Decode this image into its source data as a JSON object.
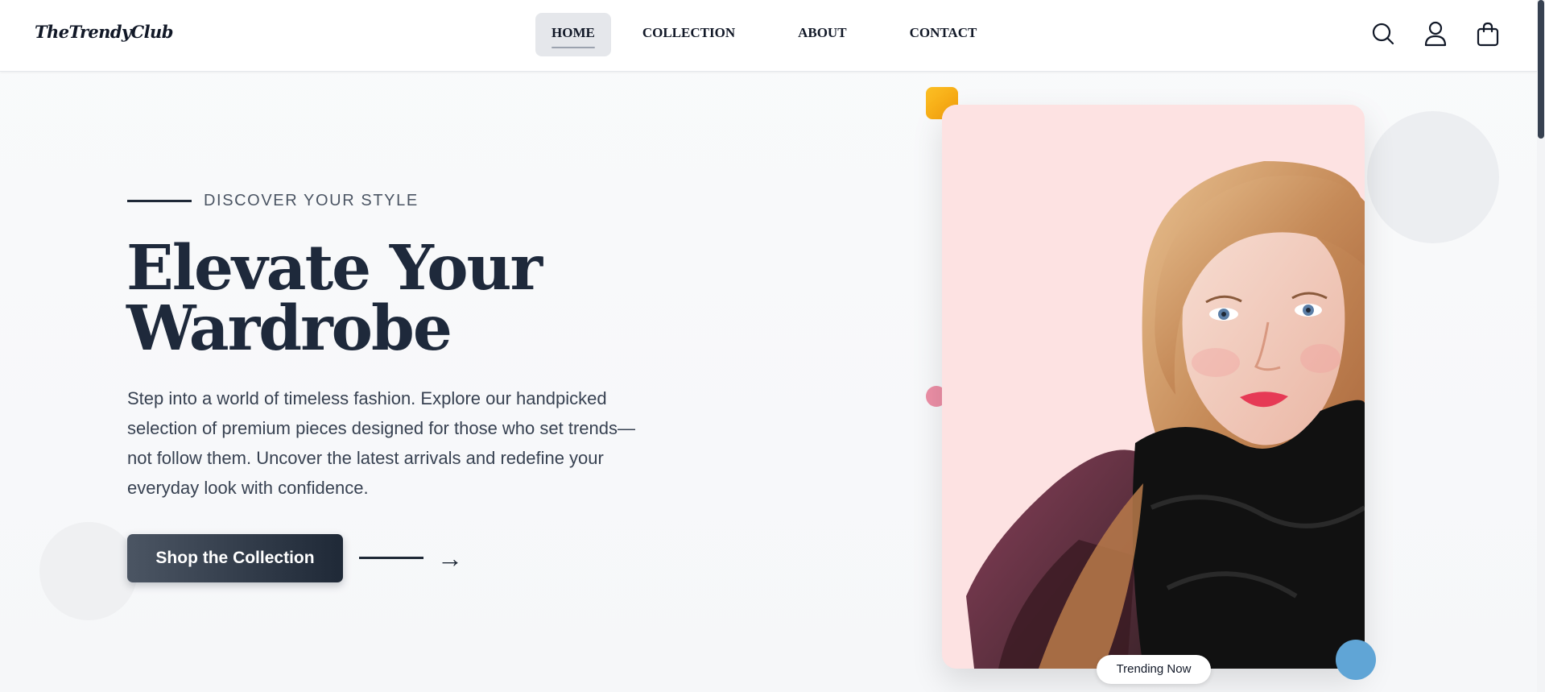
{
  "header": {
    "logo": "TheTrendyClub",
    "nav": [
      {
        "label": "HOME",
        "active": true
      },
      {
        "label": "COLLECTION",
        "active": false
      },
      {
        "label": "ABOUT",
        "active": false
      },
      {
        "label": "CONTACT",
        "active": false
      }
    ],
    "icons": [
      "search-icon",
      "user-icon",
      "shopping-bag-icon"
    ]
  },
  "hero": {
    "eyebrow": "DISCOVER YOUR STYLE",
    "headline_line1": "Elevate Your",
    "headline_line2": "Wardrobe",
    "description": "Step into a world of timeless fashion. Explore our handpicked selection of premium pieces designed for those who set trends—not follow them. Uncover the latest arrivals and redefine your everyday look with confidence.",
    "cta_label": "Shop the Collection",
    "arrow": "→"
  },
  "feature": {
    "badge": "Trending Now"
  },
  "colors": {
    "accent_dark": "#1f2937",
    "card_background": "#fde2e2",
    "deco_yellow": "#fbbf24",
    "deco_pink": "#ec8fa6",
    "deco_blue": "#60a5d6"
  }
}
